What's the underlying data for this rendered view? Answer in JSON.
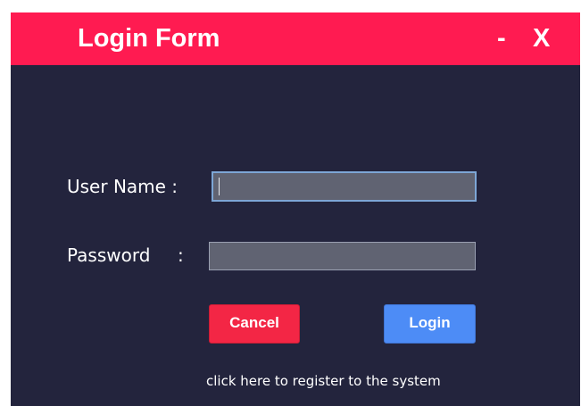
{
  "window": {
    "title": "Login Form",
    "minimize_label": "-",
    "close_label": "X",
    "colors": {
      "titlebar": "#ff1b51",
      "background": "#23243d",
      "input": "#606372",
      "cancel": "#f32645",
      "login": "#4d8cf6"
    }
  },
  "form": {
    "username_label": "User Name :",
    "password_label": "Password",
    "password_colon": ":",
    "username_value": "",
    "password_value": "",
    "cancel_label": "Cancel",
    "login_label": "Login",
    "register_link": "click here to register to the system"
  }
}
